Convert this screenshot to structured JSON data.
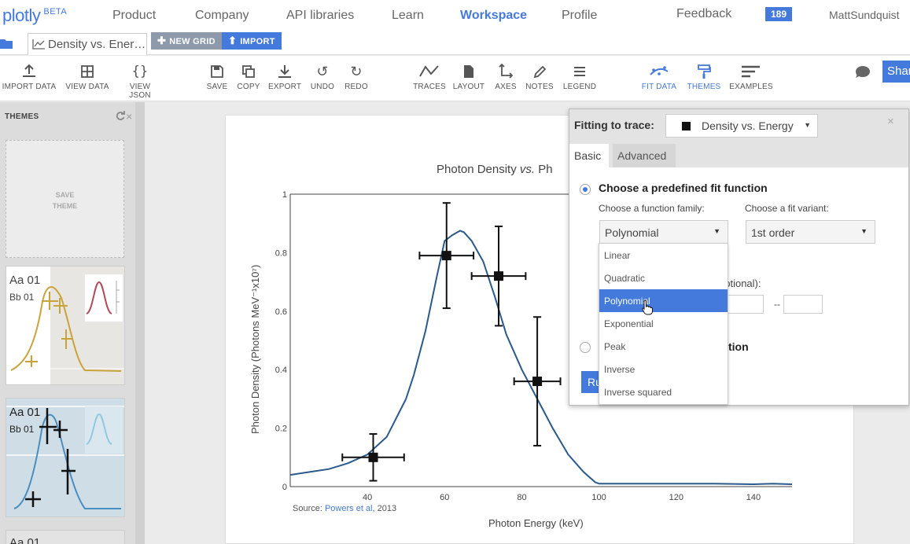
{
  "nav": {
    "logo": "plotly",
    "beta": "BETA",
    "links": [
      "Product",
      "Company",
      "API libraries",
      "Learn",
      "Workspace",
      "Profile"
    ],
    "feedback": "Feedback",
    "notification_count": "189",
    "username": "MattSundquist"
  },
  "tabstrip": {
    "grid_tab": "Density vs. Ener…",
    "new_grid": "NEW GRID",
    "import": "IMPORT"
  },
  "toolbar": {
    "import_data": "IMPORT DATA",
    "view_data": "VIEW DATA",
    "view_json": "VIEW JSON",
    "save": "SAVE",
    "copy": "COPY",
    "export": "EXPORT",
    "undo": "UNDO",
    "redo": "REDO",
    "traces": "TRACES",
    "layout": "LAYOUT",
    "axes": "AXES",
    "notes": "NOTES",
    "legend": "LEGEND",
    "fit_data": "FIT DATA",
    "themes": "THEMES",
    "examples": "EXAMPLES",
    "share": "Shar"
  },
  "sidebar": {
    "title": "THEMES",
    "save_theme": [
      "SAVE",
      "THEME"
    ],
    "themes": [
      {
        "aa": "Aa 01",
        "bb": "Bb 01"
      },
      {
        "aa": "Aa 01",
        "bb": "Bb 01"
      },
      {
        "aa": "Aa 01"
      }
    ]
  },
  "plot": {
    "title_start": "Photon Density ",
    "title_vs": "vs.",
    "title_end": " Ph",
    "ylabel": "Photon Density (Photons MeV⁻¹x10⁷)",
    "xlabel": "Photon Energy (keV)",
    "source_prefix": "Source: ",
    "source_link": "Powers et al",
    "source_suffix": ", 2013",
    "x_ticks": [
      "40",
      "60",
      "80",
      "100",
      "120",
      "140"
    ],
    "y_ticks": [
      "0",
      "0.2",
      "0.4",
      "0.6",
      "0.8",
      "1"
    ]
  },
  "chart_data": {
    "type": "scatter",
    "title": "Photon Density vs. Ph",
    "xlabel": "Photon Energy (keV)",
    "ylabel": "Photon Density (Photons MeV⁻¹x10⁷)",
    "xlim": [
      20,
      150
    ],
    "ylim": [
      0,
      1
    ],
    "series": [
      {
        "x": [
          20,
          25,
          30,
          35,
          40,
          45,
          50,
          52,
          55,
          58,
          60,
          62,
          64,
          65,
          67,
          70,
          73,
          76,
          80,
          84,
          88,
          92,
          96,
          99,
          100,
          110,
          120,
          130,
          140,
          145,
          150
        ],
        "y": [
          0.04,
          0.05,
          0.06,
          0.08,
          0.11,
          0.17,
          0.3,
          0.38,
          0.53,
          0.72,
          0.84,
          0.86,
          0.875,
          0.87,
          0.84,
          0.77,
          0.65,
          0.52,
          0.4,
          0.3,
          0.2,
          0.11,
          0.05,
          0.015,
          0.01,
          0.01,
          0.01,
          0.01,
          0.008,
          0.01,
          0.008
        ]
      },
      {
        "name": "Density vs. Energy",
        "x": [
          41.5,
          60.5,
          74,
          84
        ],
        "y": [
          0.1,
          0.79,
          0.72,
          0.36
        ],
        "x_error": [
          8,
          7,
          7,
          6
        ],
        "y_error": [
          0.08,
          0.18,
          0.17,
          0.22
        ]
      }
    ]
  },
  "fit_panel": {
    "fitting_label": "Fitting to trace:",
    "trace_name": "Density vs. Energy",
    "tab_basic": "Basic",
    "tab_advanced": "Advanced",
    "predefined": "Choose a predefined fit function",
    "family_label": "Choose a function family:",
    "variant_label": "Choose a fit variant:",
    "family_value": "Polynomial",
    "variant_value": "1st order",
    "optional": "optional):",
    "dashes": "--",
    "custom_tail": "tion",
    "run": "Ru",
    "family_options": [
      "Linear",
      "Quadratic",
      "Polynomial",
      "Exponential",
      "Peak",
      "Inverse",
      "Inverse squared"
    ]
  },
  "colors": {
    "accent": "#447adb",
    "button_gray": "#8e9aab",
    "curve": "#2a5a8c"
  }
}
